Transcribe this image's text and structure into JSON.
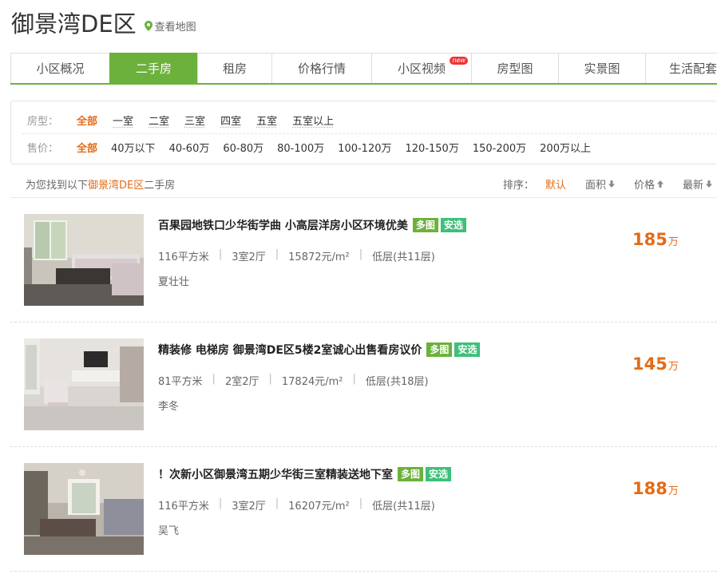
{
  "header": {
    "title": "御景湾DE区",
    "map_link": "查看地图"
  },
  "tabs": [
    {
      "label": "小区概况",
      "active": false
    },
    {
      "label": "二手房",
      "active": true
    },
    {
      "label": "租房",
      "active": false
    },
    {
      "label": "价格行情",
      "active": false
    },
    {
      "label": "小区视频",
      "active": false,
      "badge": "new"
    },
    {
      "label": "房型图",
      "active": false
    },
    {
      "label": "实景图",
      "active": false
    },
    {
      "label": "生活配套",
      "active": false
    }
  ],
  "filters": {
    "room": {
      "label": "房型：",
      "options": [
        "全部",
        "一室",
        "二室",
        "三室",
        "四室",
        "五室",
        "五室以上"
      ]
    },
    "price": {
      "label": "售价：",
      "options": [
        "全部",
        "40万以下",
        "40-60万",
        "60-80万",
        "80-100万",
        "100-120万",
        "120-150万",
        "150-200万",
        "200万以上"
      ]
    }
  },
  "summary": {
    "prefix": "为您找到以下",
    "community": "御景湾DE区",
    "suffix": "二手房",
    "sort_label": "排序：",
    "sort_default": "默认",
    "sort_area": "面积",
    "sort_price": "价格",
    "sort_new": "最新"
  },
  "listings": [
    {
      "title": "百果园地铁口少华街学曲 小高层洋房小区环境优美",
      "tag_multi": "多图",
      "tag_select": "安选",
      "area": "116平方米",
      "layout": "3室2厅",
      "unit_price": "15872元/m²",
      "floor": "低层(共11层)",
      "agent": "夏壮壮",
      "price": "185",
      "price_unit": "万"
    },
    {
      "title": "精装修 电梯房 御景湾DE区5楼2室诚心出售看房议价",
      "tag_multi": "多图",
      "tag_select": "安选",
      "area": "81平方米",
      "layout": "2室2厅",
      "unit_price": "17824元/m²",
      "floor": "低层(共18层)",
      "agent": "李冬",
      "price": "145",
      "price_unit": "万"
    },
    {
      "title": "！次新小区御景湾五期少华街三室精装送地下室",
      "tag_multi": "多图",
      "tag_select": "安选",
      "area": "116平方米",
      "layout": "3室2厅",
      "unit_price": "16207元/m²",
      "floor": "低层(共11层)",
      "agent": "吴飞",
      "price": "188",
      "price_unit": "万"
    }
  ],
  "colors": {
    "accent_green": "#6bb13b",
    "price_orange": "#e36b17",
    "select_green": "#3cc07a"
  }
}
